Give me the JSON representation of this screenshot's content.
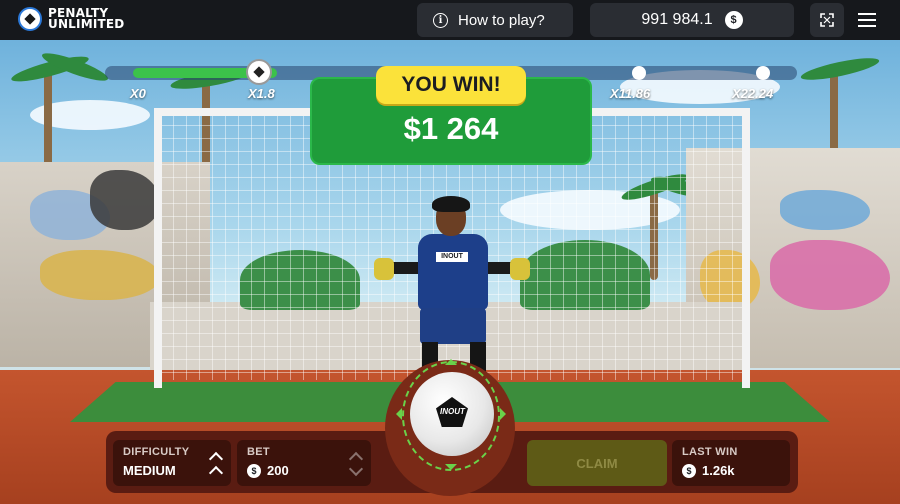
{
  "header": {
    "logo_line1": "PENALTY",
    "logo_line2": "UNLIMITED",
    "how_to_play": "How to play?",
    "info_icon": "i",
    "balance": "991 984.1",
    "currency_symbol": "$"
  },
  "progress": {
    "current_multiplier_fraction": 0.22,
    "milestones": [
      "X0",
      "X1.8",
      "X11.86",
      "X22.24"
    ]
  },
  "result": {
    "tag": "YOU WIN!",
    "amount": "$1 264"
  },
  "controls": {
    "difficulty_label": "DIFFICULTY",
    "difficulty_value": "MEDIUM",
    "bet_label": "BET",
    "bet_value": "200",
    "claim_label": "CLAIM",
    "last_win_label": "LAST WIN",
    "last_win_value": "1.26k"
  },
  "ball_brand": "INOUT",
  "keeper_badge": "INOUT",
  "colors": {
    "accent_green": "#1f9c3a",
    "win_yellow": "#fbe23a",
    "panel_dark": "#3b120b"
  }
}
